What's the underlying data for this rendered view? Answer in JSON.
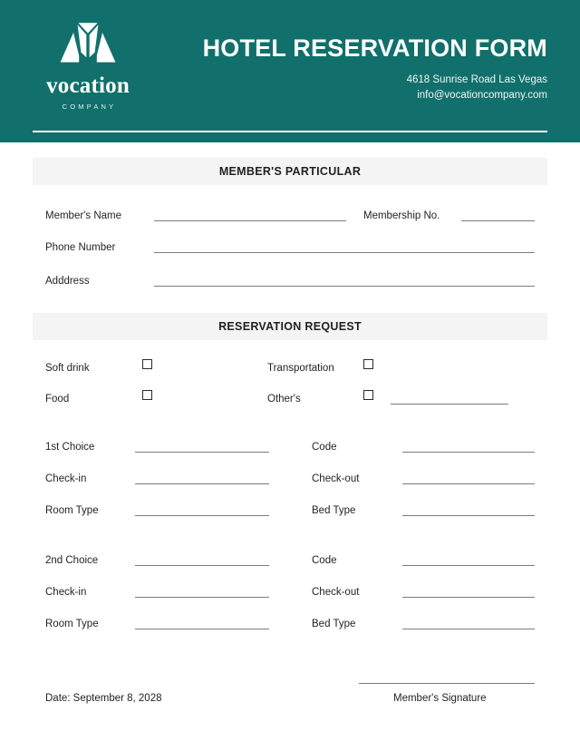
{
  "header": {
    "title": "HOTEL RESERVATION FORM",
    "address": "4618 Sunrise Road Las Vegas",
    "email": "info@vocationcompany.com",
    "brand_color": "#11706b",
    "logo": {
      "icon": "mountain-peaks-logo-icon",
      "wordmark": "vocation",
      "tagline": "COMPANY"
    }
  },
  "sections": {
    "member": {
      "band_label": "MEMBER'S PARTICULAR",
      "fields": {
        "name_label": "Member's Name",
        "name_value": "",
        "membership_no_label": "Membership No.",
        "membership_no_value": "",
        "phone_label": "Phone Number",
        "phone_value": "",
        "address_label": "Adddress",
        "address_value": ""
      }
    },
    "reservation": {
      "band_label": "RESERVATION REQUEST",
      "checkboxes": [
        {
          "label": "Soft drink",
          "checked": false
        },
        {
          "label": "Food",
          "checked": false
        },
        {
          "label": "Transportation",
          "checked": false
        },
        {
          "label": "Other's",
          "checked": false
        }
      ],
      "others_value": "",
      "choice_blocks": [
        {
          "left": [
            {
              "label": "1st Choice",
              "value": ""
            },
            {
              "label": "Check-in",
              "value": ""
            },
            {
              "label": "Room Type",
              "value": ""
            }
          ],
          "right": [
            {
              "label": "Code",
              "value": ""
            },
            {
              "label": "Check-out",
              "value": ""
            },
            {
              "label": "Bed Type",
              "value": ""
            }
          ]
        },
        {
          "left": [
            {
              "label": "2nd Choice",
              "value": ""
            },
            {
              "label": "Check-in",
              "value": ""
            },
            {
              "label": "Room Type",
              "value": ""
            }
          ],
          "right": [
            {
              "label": "Code",
              "value": ""
            },
            {
              "label": "Check-out",
              "value": ""
            },
            {
              "label": "Bed Type",
              "value": ""
            }
          ]
        }
      ]
    }
  },
  "footer": {
    "date_text": "Date: September 8, 2028",
    "signature_label": "Member's Signature",
    "signature_value": ""
  }
}
